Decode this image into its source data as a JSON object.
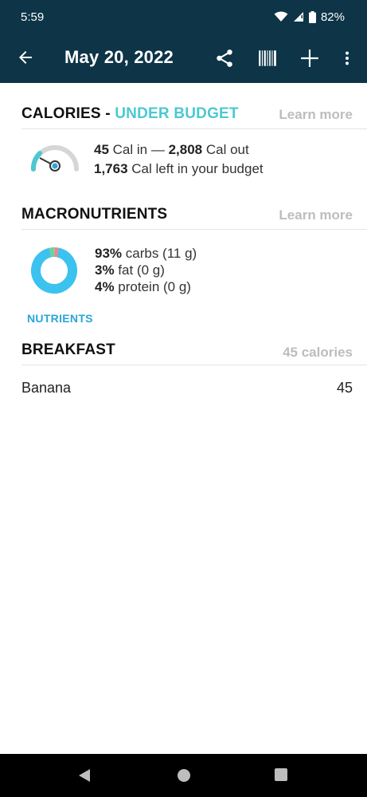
{
  "status_bar": {
    "time": "5:59",
    "battery": "82%",
    "icons": [
      "wifi-icon",
      "cell-signal-icon",
      "battery-icon"
    ]
  },
  "app_bar": {
    "title": "May 20, 2022",
    "icons": [
      "back-arrow-icon",
      "share-icon",
      "barcode-icon",
      "plus-icon",
      "more-vert-icon"
    ]
  },
  "calories": {
    "title": "CALORIES - ",
    "status": "UNDER BUDGET",
    "learn_more": "Learn more",
    "cal_in_value": "45",
    "cal_in_label": " Cal in — ",
    "cal_out_value": "2,808",
    "cal_out_label": " Cal out",
    "cal_left_value": "1,763",
    "cal_left_label": " Cal left in your budget",
    "gauge_fraction": 0.02
  },
  "macronutrients": {
    "title": "MACRONUTRIENTS",
    "learn_more": "Learn more",
    "carbs_pct": "93%",
    "carbs_label": " carbs (11 g)",
    "fat_pct": "3%",
    "fat_label": " fat (0 g)",
    "protein_pct": "4%",
    "protein_label": " protein (0 g)",
    "shares": {
      "carbs": 93,
      "fat": 3,
      "protein": 4
    },
    "colors": {
      "carbs": "#3cc2ee",
      "fat": "#f0848a",
      "protein": "#6fd0a0"
    }
  },
  "nutrients_link": "NUTRIENTS",
  "breakfast": {
    "title": "BREAKFAST",
    "calories": "45 calories",
    "items": [
      {
        "name": "Banana",
        "calories": "45"
      }
    ]
  },
  "colors": {
    "app_bar": "#0d3447",
    "accent": "#4cc8d2",
    "link": "#2aa6d8",
    "muted": "#bdbdbd"
  }
}
